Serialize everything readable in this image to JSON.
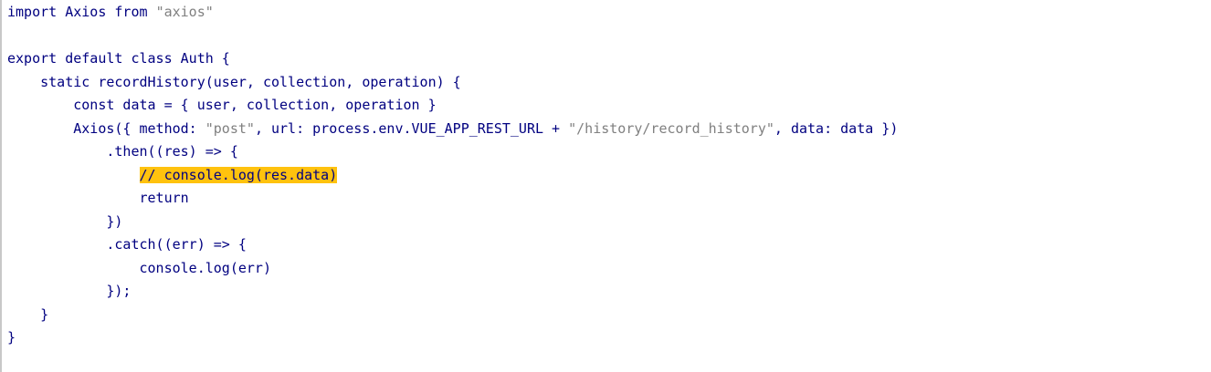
{
  "editor": {
    "lines": [
      [
        {
          "t": "import Axios from ",
          "c": "kw"
        },
        {
          "t": "\"axios\"",
          "c": "str"
        }
      ],
      [],
      [
        {
          "t": "export default class Auth {",
          "c": "kw"
        }
      ],
      [
        {
          "t": "    static recordHistory(user, collection, operation) {",
          "c": "kw"
        }
      ],
      [
        {
          "t": "        const data = { user, collection, operation }",
          "c": "kw"
        }
      ],
      [
        {
          "t": "        Axios({ method: ",
          "c": "kw"
        },
        {
          "t": "\"post\"",
          "c": "str"
        },
        {
          "t": ", url: process.env.VUE_APP_REST_URL + ",
          "c": "kw"
        },
        {
          "t": "\"/history/record_history\"",
          "c": "str"
        },
        {
          "t": ", data: data })",
          "c": "kw"
        }
      ],
      [
        {
          "t": "            .then((res) => {",
          "c": "kw"
        }
      ],
      [
        {
          "t": "                ",
          "c": "kw"
        },
        {
          "t": "// console.log(res.data)",
          "c": "hl"
        }
      ],
      [
        {
          "t": "                return",
          "c": "kw"
        }
      ],
      [
        {
          "t": "            })",
          "c": "kw"
        }
      ],
      [
        {
          "t": "            .catch((err) => {",
          "c": "kw"
        }
      ],
      [
        {
          "t": "                console.log(err)",
          "c": "kw"
        }
      ],
      [
        {
          "t": "            });",
          "c": "kw"
        }
      ],
      [
        {
          "t": "    }",
          "c": "kw"
        }
      ],
      [
        {
          "t": "}",
          "c": "kw"
        }
      ]
    ],
    "highlight_color": "#ffc20e",
    "text_color": "#000080",
    "string_color": "#808080"
  }
}
